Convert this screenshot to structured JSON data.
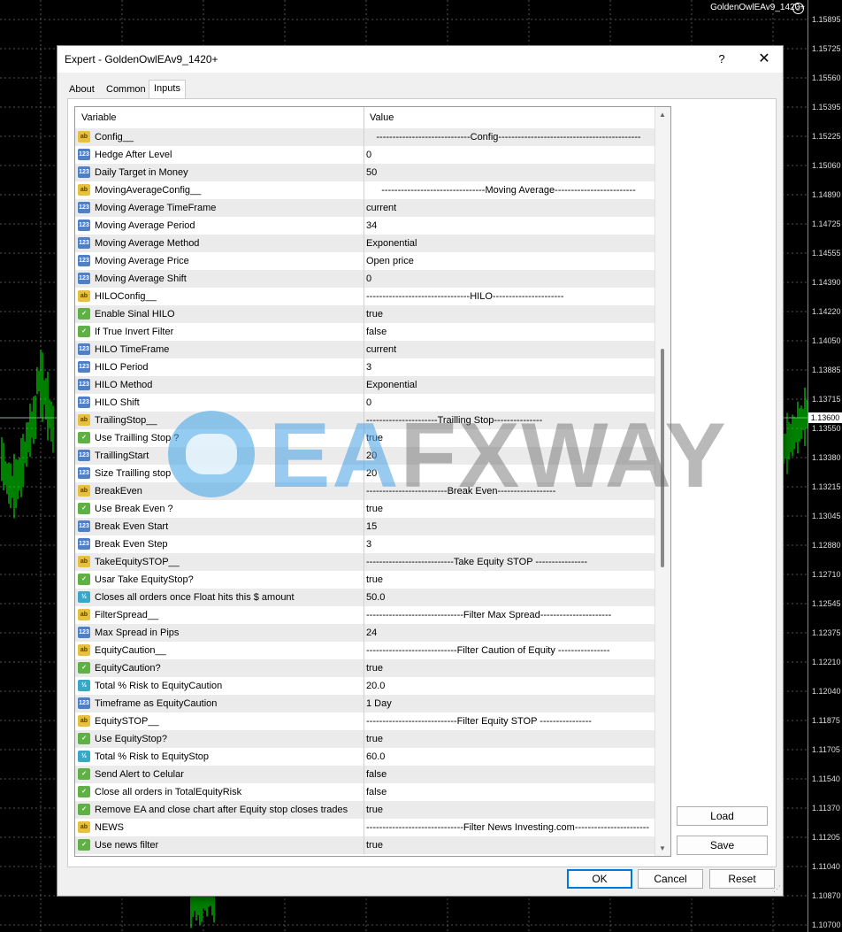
{
  "chart": {
    "symbol_title": "GoldenOwlEAv9_1420+",
    "current_price": "1.13600",
    "price_labels": [
      "1.15895",
      "1.15725",
      "1.15560",
      "1.15395",
      "1.15225",
      "1.15060",
      "1.14890",
      "1.14725",
      "1.14555",
      "1.14390",
      "1.14220",
      "1.14050",
      "1.13885",
      "1.13715",
      "1.13550",
      "1.13380",
      "1.13215",
      "1.13045",
      "1.12880",
      "1.12710",
      "1.12545",
      "1.12375",
      "1.12210",
      "1.12040",
      "1.11875",
      "1.11705",
      "1.11540",
      "1.11370",
      "1.11205",
      "1.11040",
      "1.10870",
      "1.10700"
    ]
  },
  "dialog": {
    "title": "Expert - GoldenOwlEAv9_1420+",
    "help_label": "?",
    "close_label": "✕",
    "tabs": [
      {
        "label": "About",
        "active": false
      },
      {
        "label": "Common",
        "active": false
      },
      {
        "label": "Inputs",
        "active": true
      }
    ],
    "columns": {
      "variable": "Variable",
      "value": "Value"
    },
    "rows": [
      {
        "type": "ab",
        "var": "Config__",
        "val": "-----------------------------Config--------------------------------------------",
        "center": true
      },
      {
        "type": "123",
        "var": "Hedge After Level",
        "val": "0"
      },
      {
        "type": "123",
        "var": "Daily Target in Money",
        "val": "50"
      },
      {
        "type": "ab",
        "var": "MovingAverageConfig__",
        "val": "--------------------------------Moving Average-------------------------",
        "center": true
      },
      {
        "type": "123",
        "var": "Moving Average TimeFrame",
        "val": "current"
      },
      {
        "type": "123",
        "var": "Moving Average Period",
        "val": "34"
      },
      {
        "type": "123",
        "var": "Moving Average Method",
        "val": "Exponential"
      },
      {
        "type": "123",
        "var": "Moving Average Price",
        "val": "Open price"
      },
      {
        "type": "123",
        "var": "Moving Average Shift",
        "val": "0"
      },
      {
        "type": "ab",
        "var": "HILOConfig__",
        "val": "--------------------------------HILO----------------------",
        "center": false
      },
      {
        "type": "bool",
        "var": "Enable Sinal  HILO",
        "val": "true"
      },
      {
        "type": "bool",
        "var": "If True Invert Filter",
        "val": "false"
      },
      {
        "type": "123",
        "var": "HILO TimeFrame",
        "val": "current"
      },
      {
        "type": "123",
        "var": "HILO Period",
        "val": "3"
      },
      {
        "type": "123",
        "var": "HILO Method",
        "val": "Exponential"
      },
      {
        "type": "123",
        "var": "HILO Shift",
        "val": "0"
      },
      {
        "type": "ab",
        "var": "TrailingStop__",
        "val": "----------------------Trailling Stop---------------",
        "center": false
      },
      {
        "type": "bool",
        "var": "Use Trailling Stop ?",
        "val": "true"
      },
      {
        "type": "123",
        "var": "TraillingStart",
        "val": "20"
      },
      {
        "type": "123",
        "var": "Size Trailling stop",
        "val": "20"
      },
      {
        "type": "ab",
        "var": "BreakEven",
        "val": "-------------------------Break Even------------------",
        "center": false
      },
      {
        "type": "bool",
        "var": "Use Break Even ?",
        "val": "true"
      },
      {
        "type": "123",
        "var": "Break Even Start",
        "val": "15"
      },
      {
        "type": "123",
        "var": "Break Even Step",
        "val": "3"
      },
      {
        "type": "ab",
        "var": "TakeEquitySTOP__",
        "val": "---------------------------Take  Equity STOP ----------------",
        "center": false
      },
      {
        "type": "bool",
        "var": "Usar Take EquityStop?",
        "val": "true"
      },
      {
        "type": "dbl",
        "var": "Closes all orders once Float hits this $ amount",
        "val": "50.0"
      },
      {
        "type": "ab",
        "var": "FilterSpread__",
        "val": "------------------------------Filter Max Spread----------------------",
        "center": false
      },
      {
        "type": "123",
        "var": "Max Spread in Pips",
        "val": "24"
      },
      {
        "type": "ab",
        "var": "EquityCaution__",
        "val": "----------------------------Filter Caution of Equity ----------------",
        "center": false
      },
      {
        "type": "bool",
        "var": "EquityCaution?",
        "val": "true"
      },
      {
        "type": "dbl",
        "var": "Total % Risk to EquityCaution",
        "val": "20.0"
      },
      {
        "type": "123",
        "var": "Timeframe as EquityCaution",
        "val": "1 Day"
      },
      {
        "type": "ab",
        "var": "EquitySTOP__",
        "val": "----------------------------Filter  Equity STOP ----------------",
        "center": false
      },
      {
        "type": "bool",
        "var": "Use EquityStop?",
        "val": "true"
      },
      {
        "type": "dbl",
        "var": "Total % Risk to EquityStop",
        "val": "60.0"
      },
      {
        "type": "bool",
        "var": "Send Alert to Celular",
        "val": "false"
      },
      {
        "type": "bool",
        "var": "Close all orders in TotalEquityRisk",
        "val": "false"
      },
      {
        "type": "bool",
        "var": "Remove EA and close chart after Equity stop closes trades",
        "val": "true"
      },
      {
        "type": "ab",
        "var": "NEWS",
        "val": "------------------------------Filter News Investing.com-----------------------",
        "center": false
      },
      {
        "type": "bool",
        "var": "Use news filter",
        "val": "true"
      }
    ],
    "buttons": {
      "load": "Load",
      "save": "Save",
      "ok": "OK",
      "cancel": "Cancel",
      "reset": "Reset"
    }
  },
  "watermark": {
    "part1": "EA",
    "part2": "FXWAY"
  },
  "colors": {
    "accent": "#0078d7",
    "chart_bg": "#000000",
    "candles": "#00ff00"
  }
}
